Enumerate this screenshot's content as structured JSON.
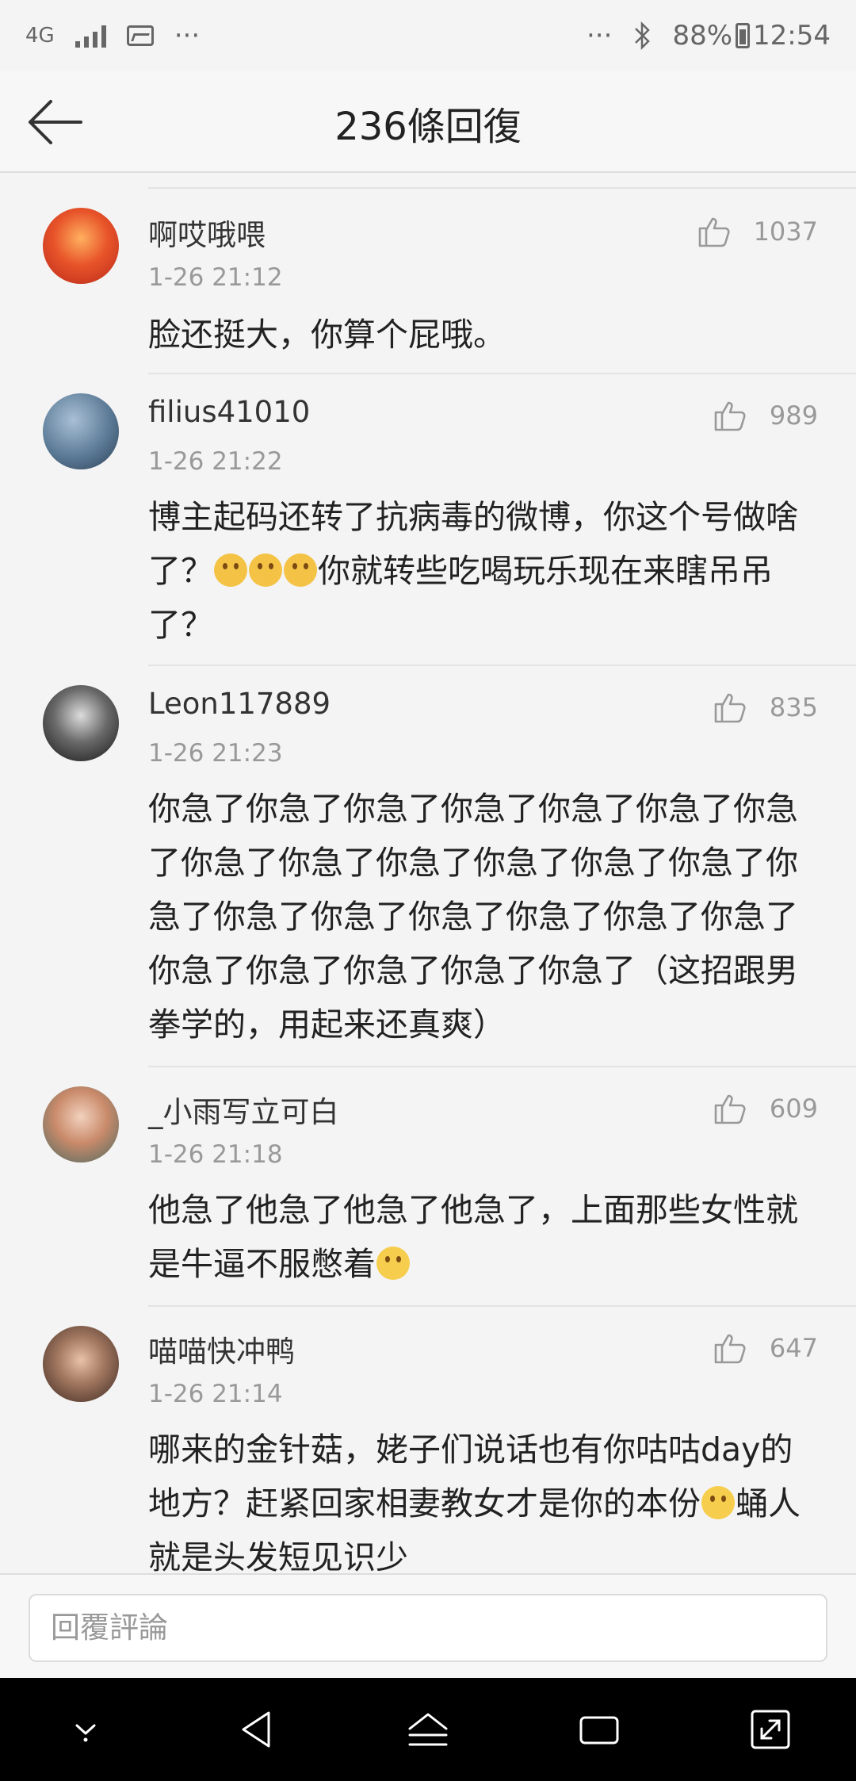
{
  "status_bar": {
    "network": "4G",
    "more": "···",
    "battery": "88%",
    "time": "12:54"
  },
  "header": {
    "title": "236條回復"
  },
  "comments": [
    {
      "user": "啊哎哦喂",
      "time": "1-26 21:12",
      "likes": "1037",
      "text": "脸还挺大，你算个屁哦。",
      "avatar_color": "#e8552a"
    },
    {
      "user": "filius41010",
      "time": "1-26 21:22",
      "likes": "989",
      "text_a": "博主起码还转了抗病毒的微博，你这个号做啥了？",
      "text_b": "你就转些吃喝玩乐现在来瞎吊吊了？",
      "avatar_color": "#5b7a96"
    },
    {
      "user": "Leon117889",
      "time": "1-26 21:23",
      "likes": "835",
      "text": "你急了你急了你急了你急了你急了你急了你急了你急了你急了你急了你急了你急了你急了你急了你急了你急了你急了你急了你急了你急了你急了你急了你急了你急了你急了（这招跟男拳学的，用起来还真爽）",
      "avatar_color": "#2a2a2a"
    },
    {
      "user": "_小雨写立可白",
      "time": "1-26 21:18",
      "likes": "609",
      "text": "他急了他急了他急了他急了，上面那些女性就是牛逼不服憋着",
      "avatar_color": "#c98a6a"
    },
    {
      "user": "喵喵快冲鸭",
      "time": "1-26 21:14",
      "likes": "647",
      "text_a": "哪来的金针菇，姥子们说话也有你咕咕day的地方？赶紧回家相妻教女才是你的本份",
      "text_b": "蛹人就是头发短见识少",
      "avatar_color": "#6b4a3a"
    }
  ],
  "reply": {
    "placeholder": "回覆評論"
  }
}
